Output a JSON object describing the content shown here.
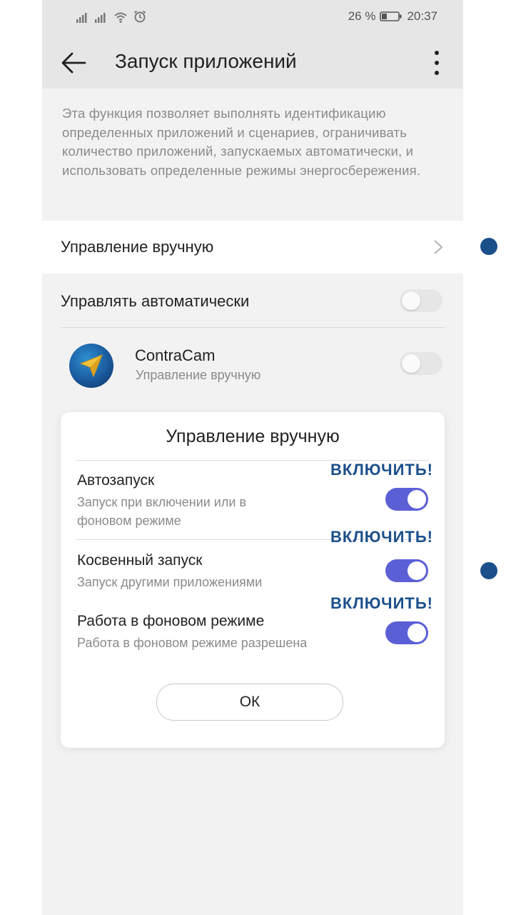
{
  "status_bar": {
    "battery_percent": "26 %",
    "time": "20:37"
  },
  "app_bar": {
    "title": "Запуск приложений"
  },
  "description": "Эта функция позволяет выполнять идентификацию определенных приложений и сценариев, ограничивать количество приложений, запускаемых автоматически, и использовать определенные режимы энергосбережения.",
  "rows": {
    "manual_label": "Управление вручную",
    "auto_label": "Управлять автоматически",
    "auto_enabled": false
  },
  "app": {
    "name": "ContraCam",
    "mode": "Управление вручную",
    "auto_enabled": false
  },
  "dialog": {
    "title": "Управление вручную",
    "options": [
      {
        "title": "Автозапуск",
        "subtitle_line1": "Запуск при включении или в",
        "subtitle_line2": "фоновом режиме",
        "enabled": true,
        "callout": "ВКЛЮЧИТЬ!"
      },
      {
        "title": "Косвенный запуск",
        "subtitle_line1": "Запуск другими приложениями",
        "enabled": true,
        "callout": "ВКЛЮЧИТЬ!"
      },
      {
        "title": "Работа в фоновом режиме",
        "subtitle_line1": "Работа в фоновом режиме разрешена",
        "enabled": true,
        "callout": "ВКЛЮЧИТЬ!"
      }
    ],
    "ok_label": "ОК"
  },
  "colors": {
    "accent": "#5b5fd6",
    "callout": "#1b4f8a"
  }
}
